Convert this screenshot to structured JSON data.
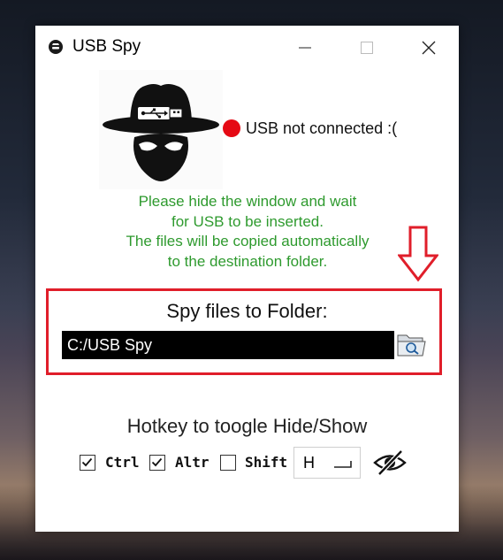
{
  "window": {
    "title": "USB Spy",
    "controls": {
      "minimize": "minimize",
      "maximize": "maximize",
      "close": "close"
    }
  },
  "status": {
    "text": "USB not connected :(",
    "color": "#e50914"
  },
  "info": {
    "lines": [
      "Please hide the window and wait",
      "for USB to be inserted.",
      "The files will be copied automatically",
      "to the destination folder."
    ],
    "color": "#2e9a2e"
  },
  "folder": {
    "label": "Spy files to Folder:",
    "path": "C:/USB Spy",
    "highlight_color": "#e01e2a"
  },
  "hotkey": {
    "label": "Hotkey to toogle Hide/Show",
    "modifiers": [
      {
        "label": "Ctrl",
        "checked": true
      },
      {
        "label": "Altr",
        "checked": true
      },
      {
        "label": "Shift",
        "checked": false
      }
    ],
    "key": "H"
  },
  "icons": {
    "app": "spy-app-icon",
    "browse": "folder-search-icon",
    "toggle": "eye-slash-icon",
    "annotation": "down-arrow-icon"
  }
}
